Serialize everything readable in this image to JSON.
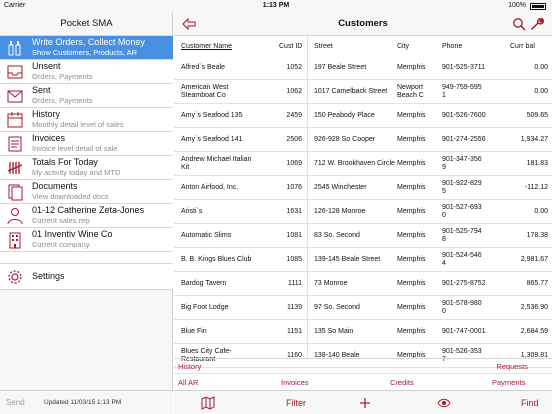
{
  "status": {
    "carrier": "Carrier",
    "time": "1:13 PM",
    "battery": "100%"
  },
  "sidebar": {
    "title": "Pocket SMA",
    "items": [
      {
        "title": "Write Orders, Collect Money",
        "sub": "Show Customers, Products, AR",
        "icon": "bottles-icon"
      },
      {
        "title": "Unsent",
        "sub": "Orders, Payments",
        "icon": "inbox-icon"
      },
      {
        "title": "Sent",
        "sub": "Orders, Payments",
        "icon": "outbox-icon"
      },
      {
        "title": "History",
        "sub": "Monthly detail level of sales",
        "icon": "calendar-icon"
      },
      {
        "title": "Invoices",
        "sub": "Invoice level detail of sale",
        "icon": "invoice-icon"
      },
      {
        "title": "Totals For Today",
        "sub": "My activity today and MTD",
        "icon": "tally-icon"
      },
      {
        "title": "Documents",
        "sub": "View downloaded docs",
        "icon": "documents-icon"
      },
      {
        "title": "01-12 Catherine Zeta-Jones",
        "sub": "Current sales rep",
        "icon": "person-icon"
      },
      {
        "title": "01 Inventiv Wine Co",
        "sub": "Current company",
        "icon": "building-icon"
      }
    ],
    "settings": "Settings",
    "footer": {
      "send": "Send",
      "updated": "Updated 11/03/15 1:13 PM"
    }
  },
  "main": {
    "title": "Customers",
    "columns": {
      "name": "Customer Name",
      "id": "Cust ID",
      "street": "Street",
      "city": "City",
      "phone": "Phone",
      "bal": "Curr bal"
    },
    "rows": [
      {
        "name": [
          "Alfred`s Beale"
        ],
        "id": "1052",
        "street": "197 Beale Street",
        "city": [
          "Memphis"
        ],
        "phone": [
          "901-525-3711"
        ],
        "bal": "0.00"
      },
      {
        "name": [
          "American West",
          "Steamboat Co"
        ],
        "id": "1062",
        "street": "1017 Camelback Street",
        "city": [
          "Newport",
          "Beach C"
        ],
        "phone": [
          "949-759-595",
          "1"
        ],
        "bal": "0.00"
      },
      {
        "name": [
          "Amy`s Seafood 135"
        ],
        "id": "2459",
        "street": "150 Peabody Place",
        "city": [
          "Memphis"
        ],
        "phone": [
          "901-526-7600"
        ],
        "bal": "509.65"
      },
      {
        "name": [
          "Amy`s Seafood 141"
        ],
        "id": "2506",
        "street": "926-928 So Cooper",
        "city": [
          "Memphis"
        ],
        "phone": [
          "901-274-2556"
        ],
        "bal": "1,934.27"
      },
      {
        "name": [
          "Andrew Michael Italian",
          "Kit"
        ],
        "id": "1069",
        "street": "712 W. Brookhaven Circle",
        "city": [
          "Memphis"
        ],
        "phone": [
          "901-347-356",
          "9"
        ],
        "bal": "181.83"
      },
      {
        "name": [
          "Anton Airfood, Inc."
        ],
        "id": "1076",
        "street": "2545 Winchester",
        "city": [
          "Memphis"
        ],
        "phone": [
          "901-922-829",
          "5"
        ],
        "bal": "-112.12"
      },
      {
        "name": [
          "Aristi`s"
        ],
        "id": "1631",
        "street": "126-128 Monroe",
        "city": [
          "Memphis"
        ],
        "phone": [
          "901-527-693",
          "0"
        ],
        "bal": "0.00"
      },
      {
        "name": [
          "Automatic Slims"
        ],
        "id": "1081",
        "street": "83 So. Second",
        "city": [
          "Memphis"
        ],
        "phone": [
          "901-525-794",
          "8"
        ],
        "bal": "178.38"
      },
      {
        "name": [
          "B. B. Kings Blues Club"
        ],
        "id": "1085",
        "street": "139-145 Beale Street",
        "city": [
          "Memphis"
        ],
        "phone": [
          "901-524-546",
          "4"
        ],
        "bal": "2,981.67"
      },
      {
        "name": [
          "Bardog Tavern"
        ],
        "id": "1111",
        "street": "73 Monroe",
        "city": [
          "Memphis"
        ],
        "phone": [
          "901-275-8752"
        ],
        "bal": "865.77"
      },
      {
        "name": [
          "Big Foot Lodge"
        ],
        "id": "1139",
        "street": "97 So. Second",
        "city": [
          "Memphis"
        ],
        "phone": [
          "901-578-980",
          "0"
        ],
        "bal": "2,536.90"
      },
      {
        "name": [
          "Blue Fin"
        ],
        "id": "1151",
        "street": "135 So Main",
        "city": [
          "Memphis"
        ],
        "phone": [
          "901-747-0001"
        ],
        "bal": "2,684.59"
      },
      {
        "name": [
          "Blues City Cafe-",
          "Restaurant"
        ],
        "id": "1160",
        "street": "138-140 Beale",
        "city": [
          "Memphis"
        ],
        "phone": [
          "901-526-353",
          "7"
        ],
        "bal": "1,309.81"
      }
    ],
    "links": {
      "history": "History",
      "requests": "Requests",
      "all_ar": "All AR",
      "invoices": "Invoices",
      "credits": "Credits",
      "payments": "Payments"
    },
    "toolbar": {
      "filter": "Filter",
      "find": "Find"
    }
  },
  "colors": {
    "accent": "#a6192e",
    "active": "#4a90e2"
  }
}
